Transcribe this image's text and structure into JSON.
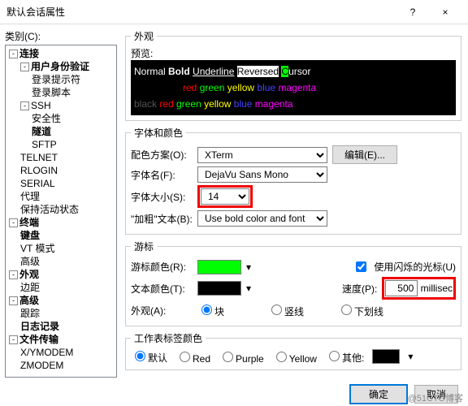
{
  "window": {
    "title": "默认会话属性",
    "help": "?",
    "close": "×"
  },
  "left": {
    "category_label": "类别(C):",
    "tree": [
      {
        "label": "连接",
        "bold": true,
        "children": [
          {
            "label": "用户身份验证",
            "bold": true,
            "children": [
              {
                "label": "登录提示符"
              },
              {
                "label": "登录脚本"
              }
            ]
          },
          {
            "label": "SSH",
            "children": [
              {
                "label": "安全性"
              },
              {
                "label": "隧道",
                "bold": true
              },
              {
                "label": "SFTP"
              }
            ]
          },
          {
            "label": "TELNET"
          },
          {
            "label": "RLOGIN"
          },
          {
            "label": "SERIAL"
          },
          {
            "label": "代理"
          },
          {
            "label": "保持活动状态"
          }
        ]
      },
      {
        "label": "终端",
        "bold": true,
        "children": [
          {
            "label": "键盘",
            "bold": true
          },
          {
            "label": "VT 模式"
          },
          {
            "label": "高级"
          }
        ]
      },
      {
        "label": "外观",
        "bold": true,
        "children": [
          {
            "label": "边距"
          }
        ]
      },
      {
        "label": "高级",
        "bold": true,
        "children": [
          {
            "label": "跟踪"
          },
          {
            "label": "日志记录",
            "bold": true
          }
        ]
      },
      {
        "label": "文件传输",
        "bold": true,
        "children": [
          {
            "label": "X/YMODEM"
          },
          {
            "label": "ZMODEM"
          }
        ]
      }
    ]
  },
  "right": {
    "appearance_group": "外观",
    "preview_label": "预览:",
    "preview_line1": [
      "Normal",
      "Bold",
      "Underline",
      "Reversed",
      "Cursor"
    ],
    "preview_colors": [
      "red",
      "green",
      "yellow",
      "blue",
      "magenta"
    ],
    "preview_line3_prefix": "black",
    "font_group": "字体和颜色",
    "scheme_label": "配色方案(O):",
    "scheme_value": "XTerm",
    "edit_btn": "编辑(E)...",
    "font_label": "字体名(F):",
    "font_value": "DejaVu Sans Mono",
    "size_label": "字体大小(S):",
    "size_value": "14",
    "bold_label": "\"加粗\"文本(B):",
    "bold_value": "Use bold color and font",
    "cursor_group": "游标",
    "cursor_color_label": "游标颜色(R):",
    "blink_label": "使用闪烁的光标(U)",
    "text_color_label": "文本颜色(T):",
    "speed_label": "速度(P):",
    "speed_value": "500",
    "speed_unit": "millisec",
    "look_label": "外观(A):",
    "look_opts": [
      "块",
      "竖线",
      "下划线"
    ],
    "tab_group": "工作表标签颜色",
    "tab_opts": [
      "默认",
      "Red",
      "Purple",
      "Yellow",
      "其他:"
    ],
    "ok": "确定",
    "cancel": "取消"
  },
  "watermark": "@51CTO博客"
}
